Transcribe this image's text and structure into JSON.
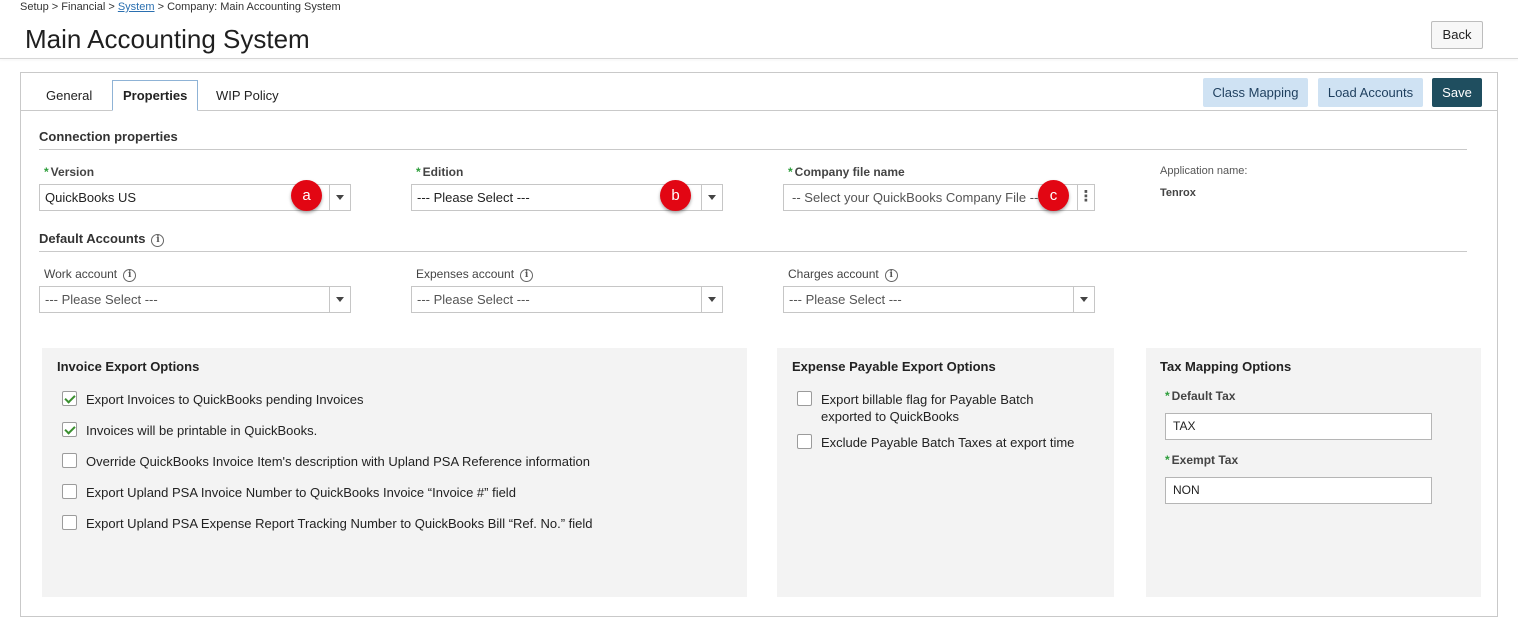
{
  "breadcrumb": {
    "part1": "Setup > Financial > ",
    "link": "System",
    "part2": " > Company: Main Accounting System"
  },
  "header": {
    "title": "Main Accounting System",
    "back_label": "Back"
  },
  "tabs": [
    {
      "label": "General"
    },
    {
      "label": "Properties"
    },
    {
      "label": "WIP Policy"
    }
  ],
  "toolbar": {
    "class_mapping": "Class Mapping",
    "load_accounts": "Load Accounts",
    "save": "Save"
  },
  "connection": {
    "title": "Connection properties",
    "version": {
      "label": "Version",
      "value": "QuickBooks US",
      "marker": "a"
    },
    "edition": {
      "label": "Edition",
      "value": "--- Please Select ---",
      "marker": "b"
    },
    "company_file": {
      "label": "Company file name",
      "value": "-- Select your QuickBooks Company File --",
      "marker": "c"
    },
    "app_name_label": "Application name:",
    "app_name_value": "Tenrox"
  },
  "default_accounts": {
    "title": "Default Accounts",
    "work": {
      "label": "Work account",
      "value": "--- Please Select ---"
    },
    "expenses": {
      "label": "Expenses account",
      "value": "--- Please Select ---"
    },
    "charges": {
      "label": "Charges account",
      "value": "--- Please Select ---"
    }
  },
  "invoice_export": {
    "title": "Invoice Export Options",
    "options": [
      {
        "label": "Export Invoices to QuickBooks pending Invoices",
        "checked": true
      },
      {
        "label": "Invoices will be printable in QuickBooks.",
        "checked": true
      },
      {
        "label": "Override QuickBooks Invoice Item's description with Upland PSA Reference information",
        "checked": false
      },
      {
        "label": "Export Upland PSA Invoice Number to QuickBooks Invoice “Invoice #” field",
        "checked": false
      },
      {
        "label": "Export Upland PSA Expense Report Tracking Number to QuickBooks Bill “Ref. No.” field",
        "checked": false
      }
    ]
  },
  "expense_export": {
    "title": "Expense Payable Export Options",
    "options": [
      {
        "label_line1": "Export billable flag for Payable Batch",
        "label_line2": "exported to QuickBooks",
        "checked": false
      },
      {
        "label_line1": "Exclude Payable Batch Taxes at export time",
        "checked": false
      }
    ]
  },
  "tax_mapping": {
    "title": "Tax Mapping Options",
    "default_tax": {
      "label": "Default Tax",
      "value": "TAX"
    },
    "exempt_tax": {
      "label": "Exempt Tax",
      "value": "NON"
    }
  },
  "colors": {
    "accent_dark": "#1f4e5f",
    "accent_light": "#cfe2f3",
    "marker_red": "#e20613",
    "required_green": "#2e9e3c"
  },
  "icons": [
    "info-icon",
    "chevron-down-icon",
    "kebab-icon",
    "checkmark-icon"
  ]
}
